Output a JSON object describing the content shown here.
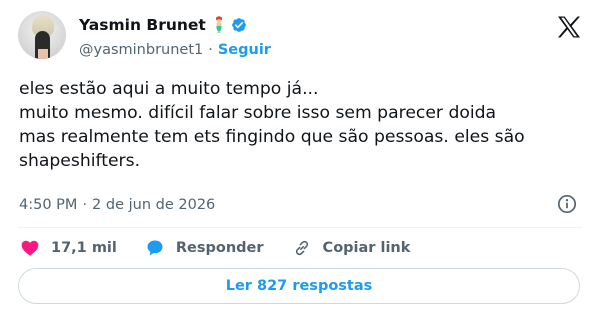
{
  "author": {
    "name": "Yasmin Brunet",
    "handle": "@yasminbrunet1",
    "follow_label": "Seguir"
  },
  "tweet": {
    "text": "eles estão aqui a muito tempo já...\nmuito mesmo. difícil falar sobre isso sem parecer doida\nmas realmente tem ets fingindo que são pessoas. eles são\nshapeshifters.",
    "time": "4:50 PM",
    "separator": "·",
    "date": "2 de jun de 2026"
  },
  "actions": {
    "likes": "17,1 mil",
    "reply_label": "Responder",
    "copy_link_label": "Copiar link"
  },
  "read_replies_label": "Ler 827 respostas",
  "colors": {
    "accent": "#1d9bf0",
    "like": "#f91880",
    "secondary_text": "#536471"
  }
}
